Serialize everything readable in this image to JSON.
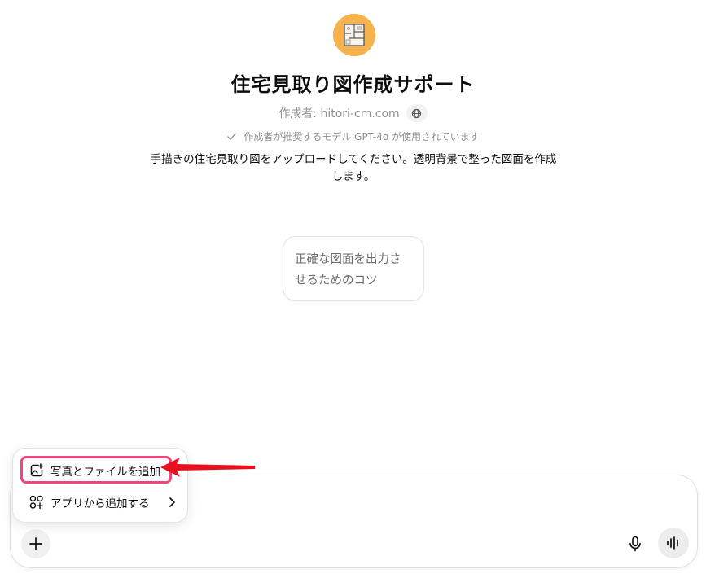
{
  "gpt": {
    "title": "住宅見取り図作成サポート",
    "author": "作成者: hitori-cm.com",
    "model_note": "作成者が推奨するモデル GPT-4o が使用されています",
    "description": "手描きの住宅見取り図をアップロードしてください。透明背景で整った図面を作成します。",
    "avatar_icon": "floorplan-icon",
    "avatar_color": "#f6b24c"
  },
  "starters": [
    {
      "label": "正確な図面を出力させるためのコツ"
    }
  ],
  "composer": {
    "plus_icon": "plus-icon",
    "mic_icon": "microphone-icon",
    "voice_icon": "voice-mode-icon"
  },
  "attach_menu": {
    "items": [
      {
        "label": "写真とファイルを追加",
        "icon": "add-photo-icon"
      },
      {
        "label": "アプリから追加する",
        "icon": "apps-icon",
        "has_submenu": true
      }
    ]
  },
  "annotation": {
    "highlight_color": "#f0457a",
    "arrow_color": "#e8101e"
  }
}
